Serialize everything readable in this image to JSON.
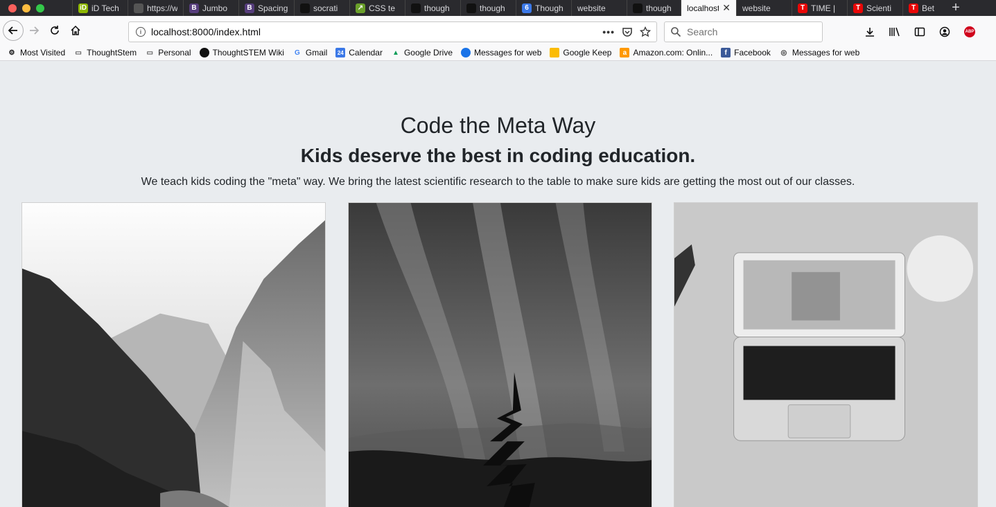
{
  "tabs": [
    {
      "label": "iD Tech",
      "icon": "id-tech-icon",
      "color": "#8db600",
      "glyph": "iD"
    },
    {
      "label": "https://www",
      "icon": "blank-page-icon",
      "color": "#555",
      "glyph": ""
    },
    {
      "label": "Jumbo",
      "icon": "bootstrap-icon",
      "color": "#563d7c",
      "glyph": "B"
    },
    {
      "label": "Spacing",
      "icon": "bootstrap-icon",
      "color": "#563d7c",
      "glyph": "B"
    },
    {
      "label": "socrati",
      "icon": "github-icon",
      "color": "#111",
      "glyph": ""
    },
    {
      "label": "CSS te",
      "icon": "css-icon",
      "color": "#6a9f2a",
      "glyph": "↗"
    },
    {
      "label": "though",
      "icon": "github-icon",
      "color": "#111",
      "glyph": ""
    },
    {
      "label": "though",
      "icon": "github-icon",
      "color": "#111",
      "glyph": ""
    },
    {
      "label": "Though",
      "icon": "calendar-icon",
      "color": "#3b78e7",
      "glyph": "6"
    },
    {
      "label": "website",
      "icon": "none",
      "color": "transparent",
      "glyph": ""
    },
    {
      "label": "though",
      "icon": "github-icon",
      "color": "#111",
      "glyph": ""
    },
    {
      "label": "localhost",
      "icon": "none",
      "color": "transparent",
      "glyph": "",
      "active": true
    },
    {
      "label": "website",
      "icon": "none",
      "color": "transparent",
      "glyph": ""
    },
    {
      "label": "TIME |",
      "icon": "time-icon",
      "color": "#e90606",
      "glyph": "T"
    },
    {
      "label": "Scienti",
      "icon": "time-icon",
      "color": "#e90606",
      "glyph": "T"
    },
    {
      "label": "Bet",
      "icon": "time-icon",
      "color": "#e90606",
      "glyph": "T"
    }
  ],
  "url": "localhost:8000/index.html",
  "search_placeholder": "Search",
  "bookmarks": [
    {
      "label": "Most Visited",
      "icon": "gear-icon"
    },
    {
      "label": "ThoughtStem",
      "icon": "folder-icon"
    },
    {
      "label": "Personal",
      "icon": "folder-icon"
    },
    {
      "label": "ThoughtSTEM Wiki",
      "icon": "github-icon"
    },
    {
      "label": "Gmail",
      "icon": "google-icon"
    },
    {
      "label": "Calendar",
      "icon": "calendar-icon"
    },
    {
      "label": "Google Drive",
      "icon": "drive-icon"
    },
    {
      "label": "Messages for web",
      "icon": "messages-icon"
    },
    {
      "label": "Google Keep",
      "icon": "keep-icon"
    },
    {
      "label": "Amazon.com: Onlin...",
      "icon": "amazon-icon"
    },
    {
      "label": "Facebook",
      "icon": "facebook-icon"
    },
    {
      "label": "Messages for web",
      "icon": "globe-icon"
    }
  ],
  "hero": {
    "title": "Code the Meta Way",
    "subtitle": "Kids deserve the best in coding education.",
    "lead": "We teach kids coding the \"meta\" way. We bring the latest scientific research to the table to make sure kids are getting the most out of our classes."
  },
  "cards": [
    {
      "image": "mountain-valley-photo"
    },
    {
      "image": "aurora-night-photo"
    },
    {
      "image": "laptop-desk-photo"
    }
  ],
  "calendar_day": "24",
  "abp_label": "ABP"
}
